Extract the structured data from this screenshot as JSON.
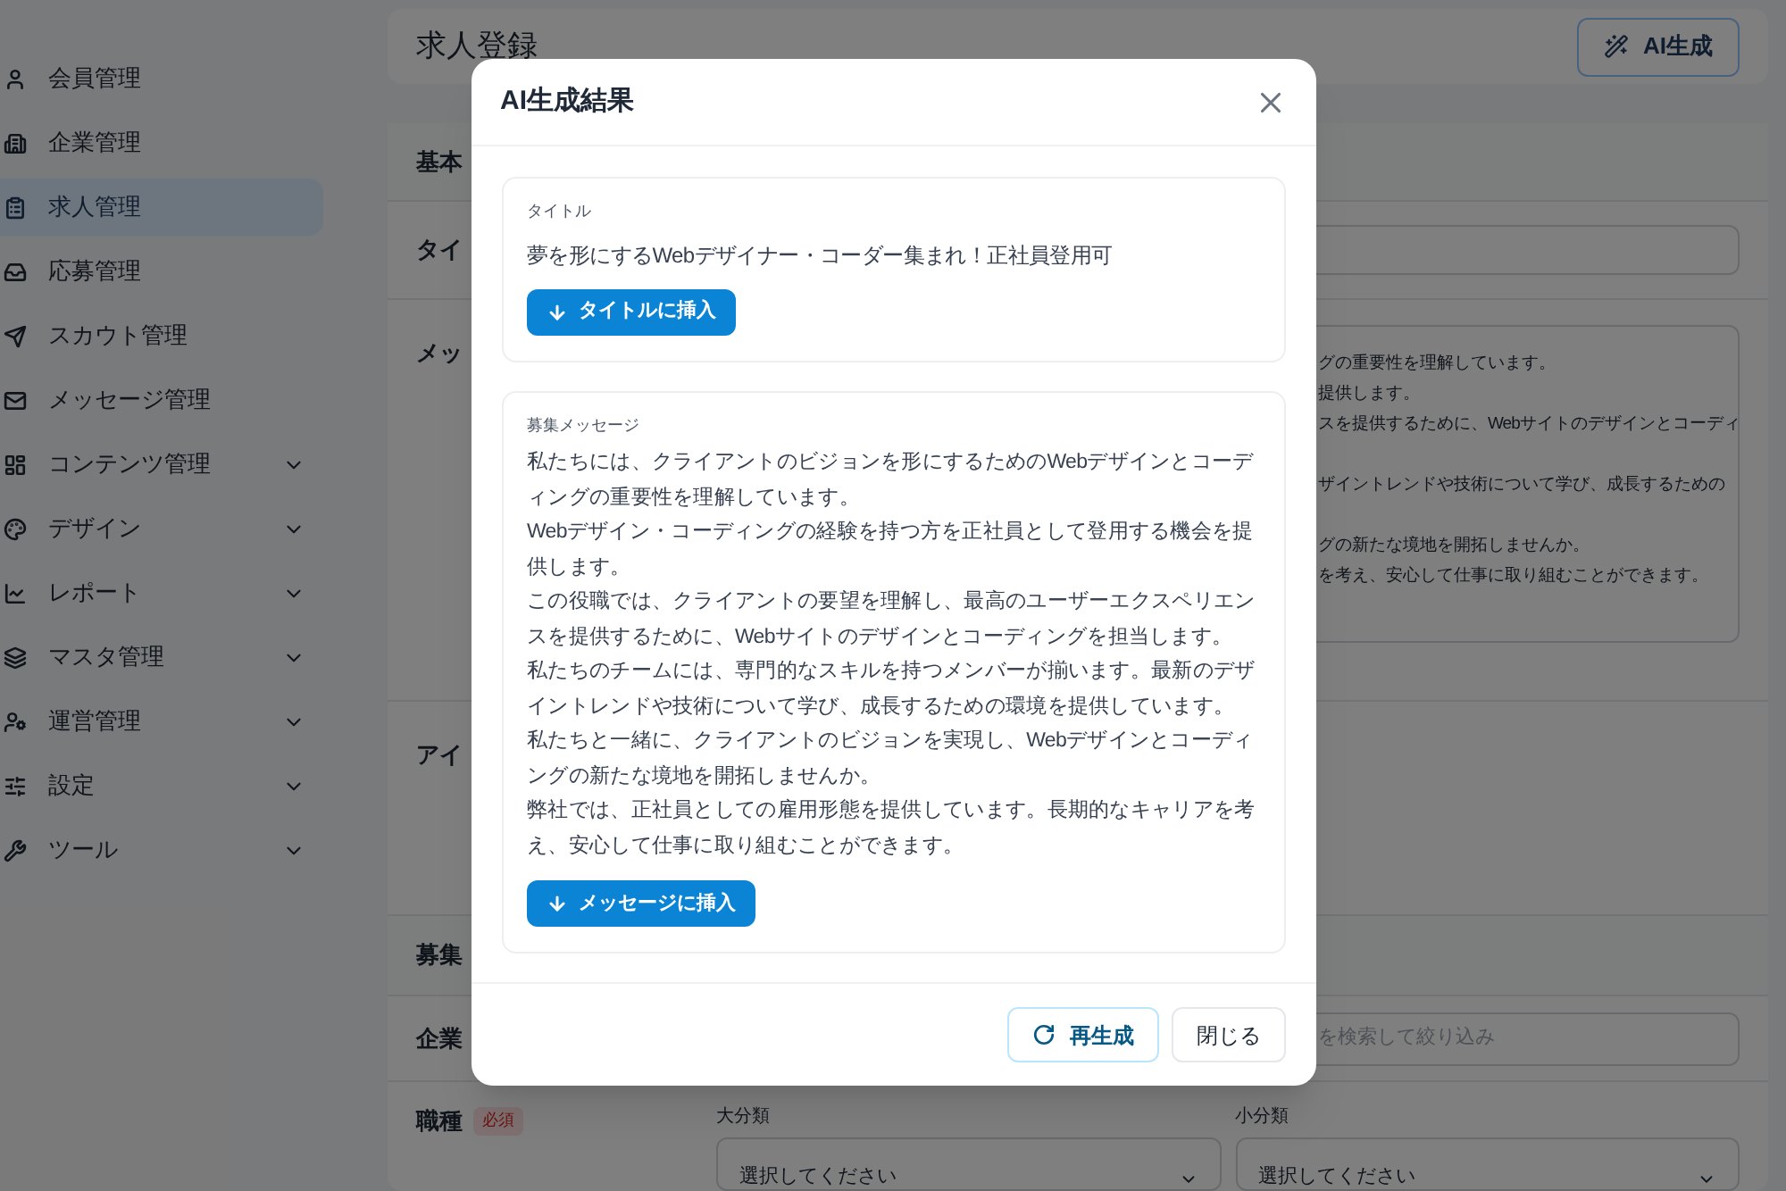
{
  "sidebar": {
    "items": [
      {
        "label": "会員管理",
        "selected": false,
        "has_submenu": false
      },
      {
        "label": "企業管理",
        "selected": false,
        "has_submenu": false
      },
      {
        "label": "求人管理",
        "selected": true,
        "has_submenu": false
      },
      {
        "label": "応募管理",
        "selected": false,
        "has_submenu": false
      },
      {
        "label": "スカウト管理",
        "selected": false,
        "has_submenu": false
      },
      {
        "label": "メッセージ管理",
        "selected": false,
        "has_submenu": false
      },
      {
        "label": "コンテンツ管理",
        "selected": false,
        "has_submenu": true
      },
      {
        "label": "デザイン",
        "selected": false,
        "has_submenu": true
      },
      {
        "label": "レポート",
        "selected": false,
        "has_submenu": true
      },
      {
        "label": "マスタ管理",
        "selected": false,
        "has_submenu": true
      },
      {
        "label": "運営管理",
        "selected": false,
        "has_submenu": true
      },
      {
        "label": "設定",
        "selected": false,
        "has_submenu": true
      },
      {
        "label": "ツール",
        "selected": false,
        "has_submenu": true
      }
    ]
  },
  "page": {
    "title": "求人登録",
    "ai_button": "AI生成"
  },
  "form": {
    "section_basic": "基本",
    "title_label": "タイ",
    "message_label": "メッ",
    "message_value": [
      [
        "グの重要性を理解しています。",
        "提供します。",
        "スを提供するために、Webサイトのデザインとコーディ"
      ],
      [
        "ザイントレンドや技術について学び、成長するための"
      ],
      [
        "グの新たな境地を開拓しませんか。",
        "を考え、安心して仕事に取り組むことができます。"
      ]
    ],
    "eyecatch_label": "アイ",
    "section_recruit": "募集",
    "company_label": "企業",
    "company_placeholder": "を検索して絞り込み",
    "job_label": "職種",
    "required_badge": "必須",
    "major_label": "大分類",
    "minor_label": "小分類",
    "major_placeholder": "選択してください",
    "minor_placeholder": "選択してください"
  },
  "dialog": {
    "title": "AI生成結果",
    "title_card": {
      "label": "タイトル",
      "text": "夢を形にするWebデザイナー・コーダー集まれ！正社員登用可",
      "button": "タイトルに挿入"
    },
    "message_card": {
      "label": "募集メッセージ",
      "paragraphs": [
        "私たちには、クライアントのビジョンを形にするためのWebデザインとコーディングの重要性を理解しています。",
        "Webデザイン・コーディングの経験を持つ方を正社員として登用する機会を提供します。",
        "この役職では、クライアントの要望を理解し、最高のユーザーエクスペリエンスを提供するために、Webサイトのデザインとコーディングを担当します。",
        "私たちのチームには、専門的なスキルを持つメンバーが揃います。最新のデザイントレンドや技術について学び、成長するための環境を提供しています。",
        "私たちと一緒に、クライアントのビジョンを実現し、Webデザインとコーディングの新たな境地を開拓しませんか。",
        "弊社では、正社員としての雇用形態を提供しています。長期的なキャリアを考え、安心して仕事に取り組むことができます。"
      ],
      "button": "メッセージに挿入"
    },
    "regenerate_button": "再生成",
    "close_button": "閉じる"
  }
}
